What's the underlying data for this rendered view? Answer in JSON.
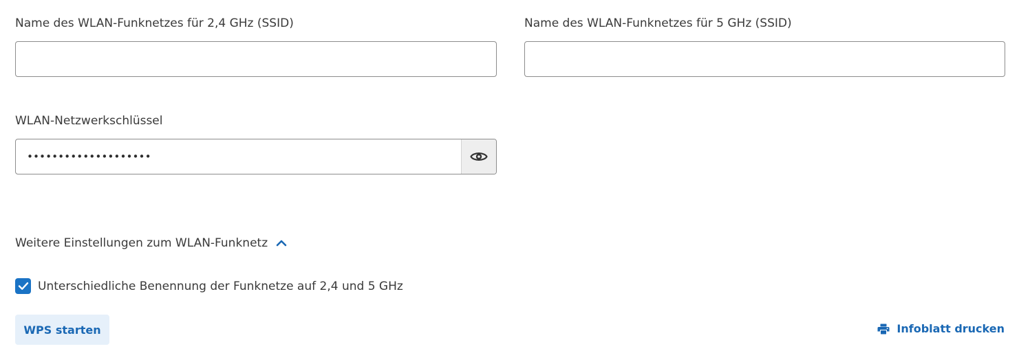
{
  "wifi": {
    "ssid_24": {
      "label": "Name des WLAN-Funknetzes für 2,4 GHz (SSID)",
      "value": ""
    },
    "ssid_5": {
      "label": "Name des WLAN-Funknetzes für 5 GHz (SSID)",
      "value": ""
    },
    "key": {
      "label": "WLAN-Netzwerkschlüssel",
      "value": "••••••••••••••••••••",
      "reveal_icon": "eye-icon"
    }
  },
  "advanced": {
    "toggle_label": "Weitere Einstellungen zum WLAN-Funknetz",
    "toggle_icon": "chevron-up-icon",
    "expanded": true,
    "separate_names": {
      "label": "Unterschiedliche Benennung der Funknetze auf 2,4 und 5 GHz",
      "checked": true
    }
  },
  "actions": {
    "wps_label": "WPS starten",
    "print_label": "Infoblatt drucken",
    "print_icon": "printer-icon"
  },
  "colors": {
    "accent": "#1a68b4",
    "checkbox": "#1a73c5",
    "wps_bg": "#e6f0fa",
    "text": "#3a3a3a",
    "border": "#8c8c8c"
  }
}
